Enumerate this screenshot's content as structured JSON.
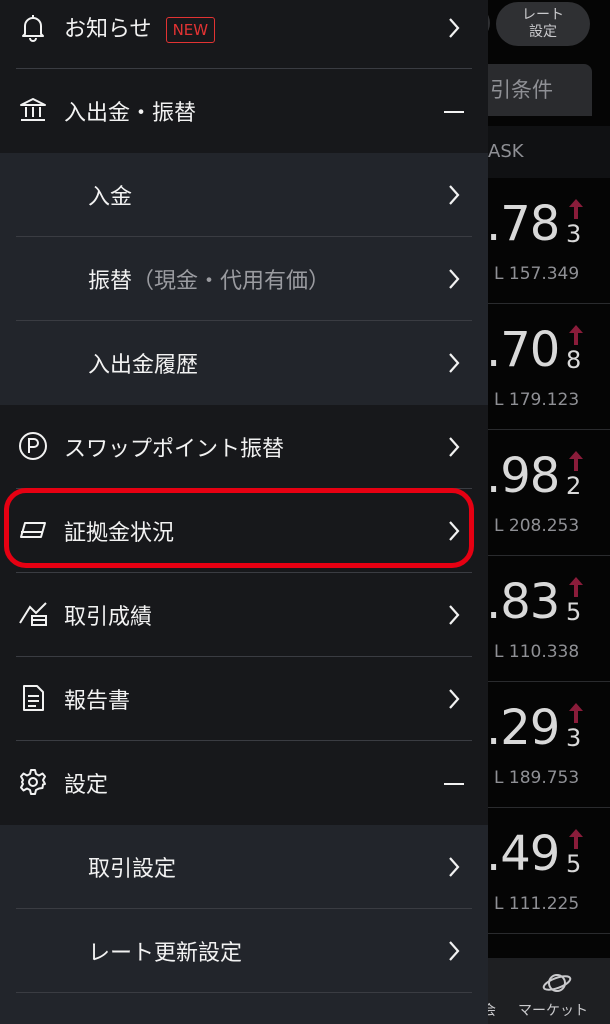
{
  "background": {
    "rate_settings_button": "レート\n設定",
    "rate_settings_line1": "レート",
    "rate_settings_line2": "設定",
    "trade_condition_tab": "引条件",
    "ask_header": "ASK",
    "quotes": [
      {
        "big": ".78",
        "small": "3",
        "low": "L 157.349"
      },
      {
        "big": ".70",
        "small": "8",
        "low": "L 179.123"
      },
      {
        "big": ".98",
        "small": "2",
        "low": "L 208.253"
      },
      {
        "big": ".83",
        "small": "5",
        "low": "L 110.338"
      },
      {
        "big": ".29",
        "small": "3",
        "low": "L 189.753"
      },
      {
        "big": ".49",
        "small": "5",
        "low": "L 111.225"
      }
    ],
    "nav": {
      "partial_label": "会",
      "market_label": "マーケット"
    },
    "colors": {
      "up_arrow": "#8a1c3a"
    }
  },
  "menu": {
    "notice": {
      "label": "お知らせ",
      "badge": "NEW",
      "icon": "bell-icon"
    },
    "deposit_transfer": {
      "label": "入出金・振替",
      "icon": "bank-icon",
      "state": "expanded"
    },
    "deposit": {
      "label": "入金"
    },
    "transfer": {
      "label": "振替",
      "label_note": "（現金・代用有価）"
    },
    "deposit_history": {
      "label": "入出金履歴"
    },
    "swap_transfer": {
      "label": "スワップポイント振替",
      "icon": "point-icon"
    },
    "margin_status": {
      "label": "証拠金状況",
      "icon": "margin-icon",
      "highlighted": true
    },
    "trade_results": {
      "label": "取引成績",
      "icon": "chart-icon"
    },
    "reports": {
      "label": "報告書",
      "icon": "document-icon"
    },
    "settings": {
      "label": "設定",
      "icon": "gear-icon",
      "state": "expanded"
    },
    "trade_settings": {
      "label": "取引設定"
    },
    "rate_update_settings": {
      "label": "レート更新設定"
    }
  },
  "colors": {
    "highlight": "#e60012",
    "badge": "#e23333"
  }
}
